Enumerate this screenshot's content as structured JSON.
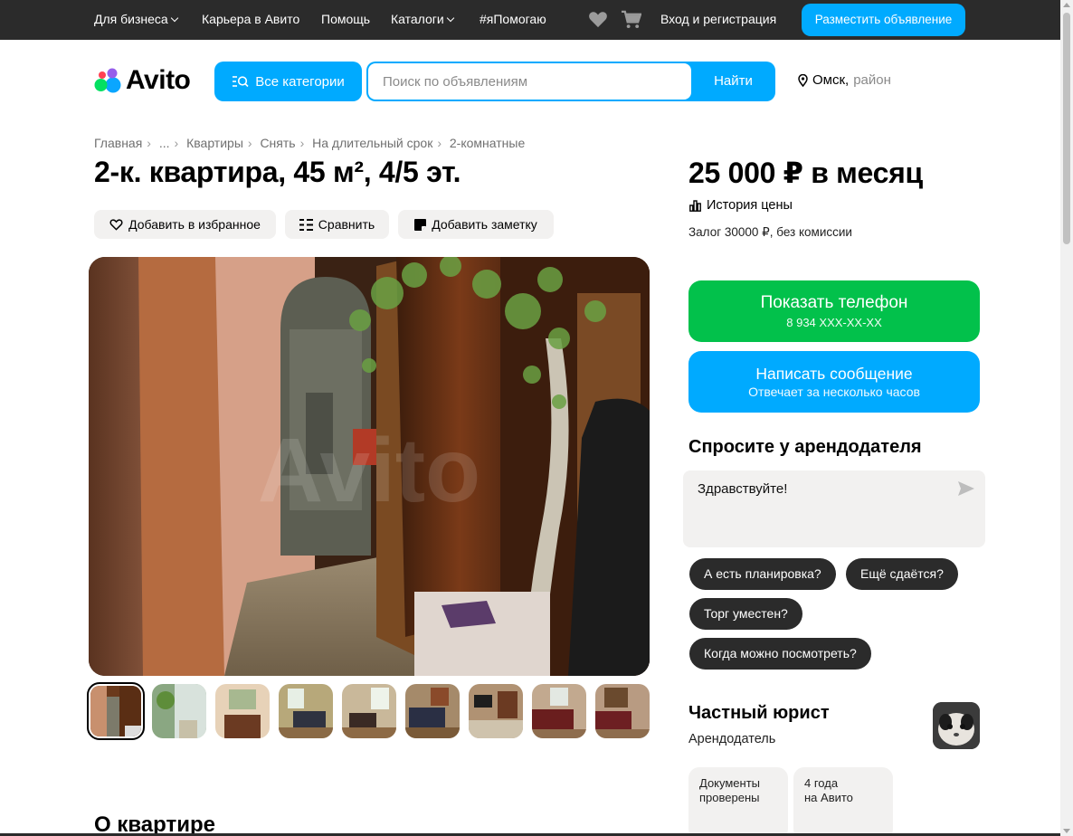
{
  "topbar": {
    "items": [
      "Для бизнеса",
      "Карьера в Авито",
      "Помощь",
      "Каталоги",
      "#яПомогаю"
    ],
    "login": "Вход и регистрация",
    "post_ad": "Разместить объявление",
    "icons": [
      "heart-icon",
      "cart-icon"
    ]
  },
  "header": {
    "logo": "Avito",
    "all_categories": "Все категории",
    "search_placeholder": "Поиск по объявлениям",
    "search_button": "Найти",
    "city": "Омск,",
    "district": "район"
  },
  "breadcrumb": [
    "Главная",
    "...",
    "Квартиры",
    "Снять",
    "На длительный срок",
    "2-комнатные"
  ],
  "listing": {
    "title": "2-к. квартира, 45 м², 4/5 эт.",
    "actions": {
      "favorite": "Добавить в избранное",
      "compare": "Сравнить",
      "note": "Добавить заметку"
    },
    "thumbnail_count": 9,
    "active_thumbnail": 1,
    "section_title": "О квартире"
  },
  "sidebar": {
    "price": "25 000 ₽ в месяц",
    "price_history": "История цены",
    "deposit": "Залог 30000 ₽, без комиссии",
    "show_phone": "Показать телефон",
    "phone_masked": "8 934 XXX-XX-XX",
    "write_message": "Написать сообщение",
    "reply_time": "Отвечает за несколько часов",
    "ask_title": "Спросите у арендодателя",
    "ask_text": "Здравствуйте!",
    "quick_questions": [
      "А есть планировка?",
      "Ещё сдаётся?",
      "Торг уместен?",
      "Когда можно посмотреть?"
    ],
    "seller_name": "Частный юрист",
    "seller_role": "Арендодатель",
    "badge_docs": [
      "Документы",
      "проверены"
    ],
    "badge_years": [
      "4 года",
      "на Авито"
    ]
  },
  "colors": {
    "blue": "#00aaff",
    "green": "#02c14b",
    "dark": "#2b2b2b",
    "chip_bg": "#f2f1f0"
  }
}
